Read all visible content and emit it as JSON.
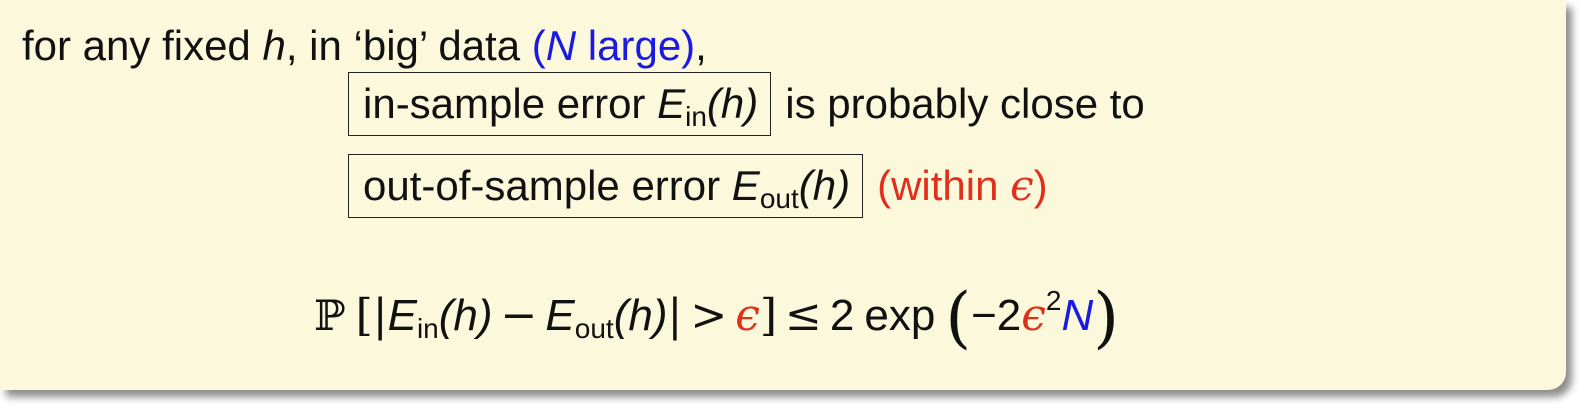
{
  "line1": {
    "pre": "for any fixed ",
    "h": "h",
    "mid": ", in ‘big’ data ",
    "open": "(",
    "N": "N",
    "large": " large)",
    "comma": ","
  },
  "row2": {
    "box_text": "in-sample error ",
    "E": "E",
    "sub": "in",
    "arg": "(h)",
    "after": "is probably close to"
  },
  "row3": {
    "box_text": "out-of-sample error ",
    "E": "E",
    "sub": "out",
    "arg": "(h)",
    "after_open": "(within ",
    "eps": "ϵ",
    "after_close": ")"
  },
  "formula": {
    "prob": "ℙ",
    "lbr": "[",
    "bar": "|",
    "E1": "E",
    "sub1": "in",
    "arg1": "(h)",
    "minus": "−",
    "E2": "E",
    "sub2": "out",
    "arg2": "(h)",
    "gt": ">",
    "eps": "ϵ",
    "rbr": "]",
    "leq": "≤",
    "two": "2",
    "exp": "exp",
    "lp": "(",
    "neg2": "−2",
    "eps2": "ϵ",
    "sq": "2",
    "N": "N",
    "rp": ")"
  },
  "colors": {
    "background": "#fbf8dc",
    "blue": "#1a1ae0",
    "red": "#e0301c"
  }
}
